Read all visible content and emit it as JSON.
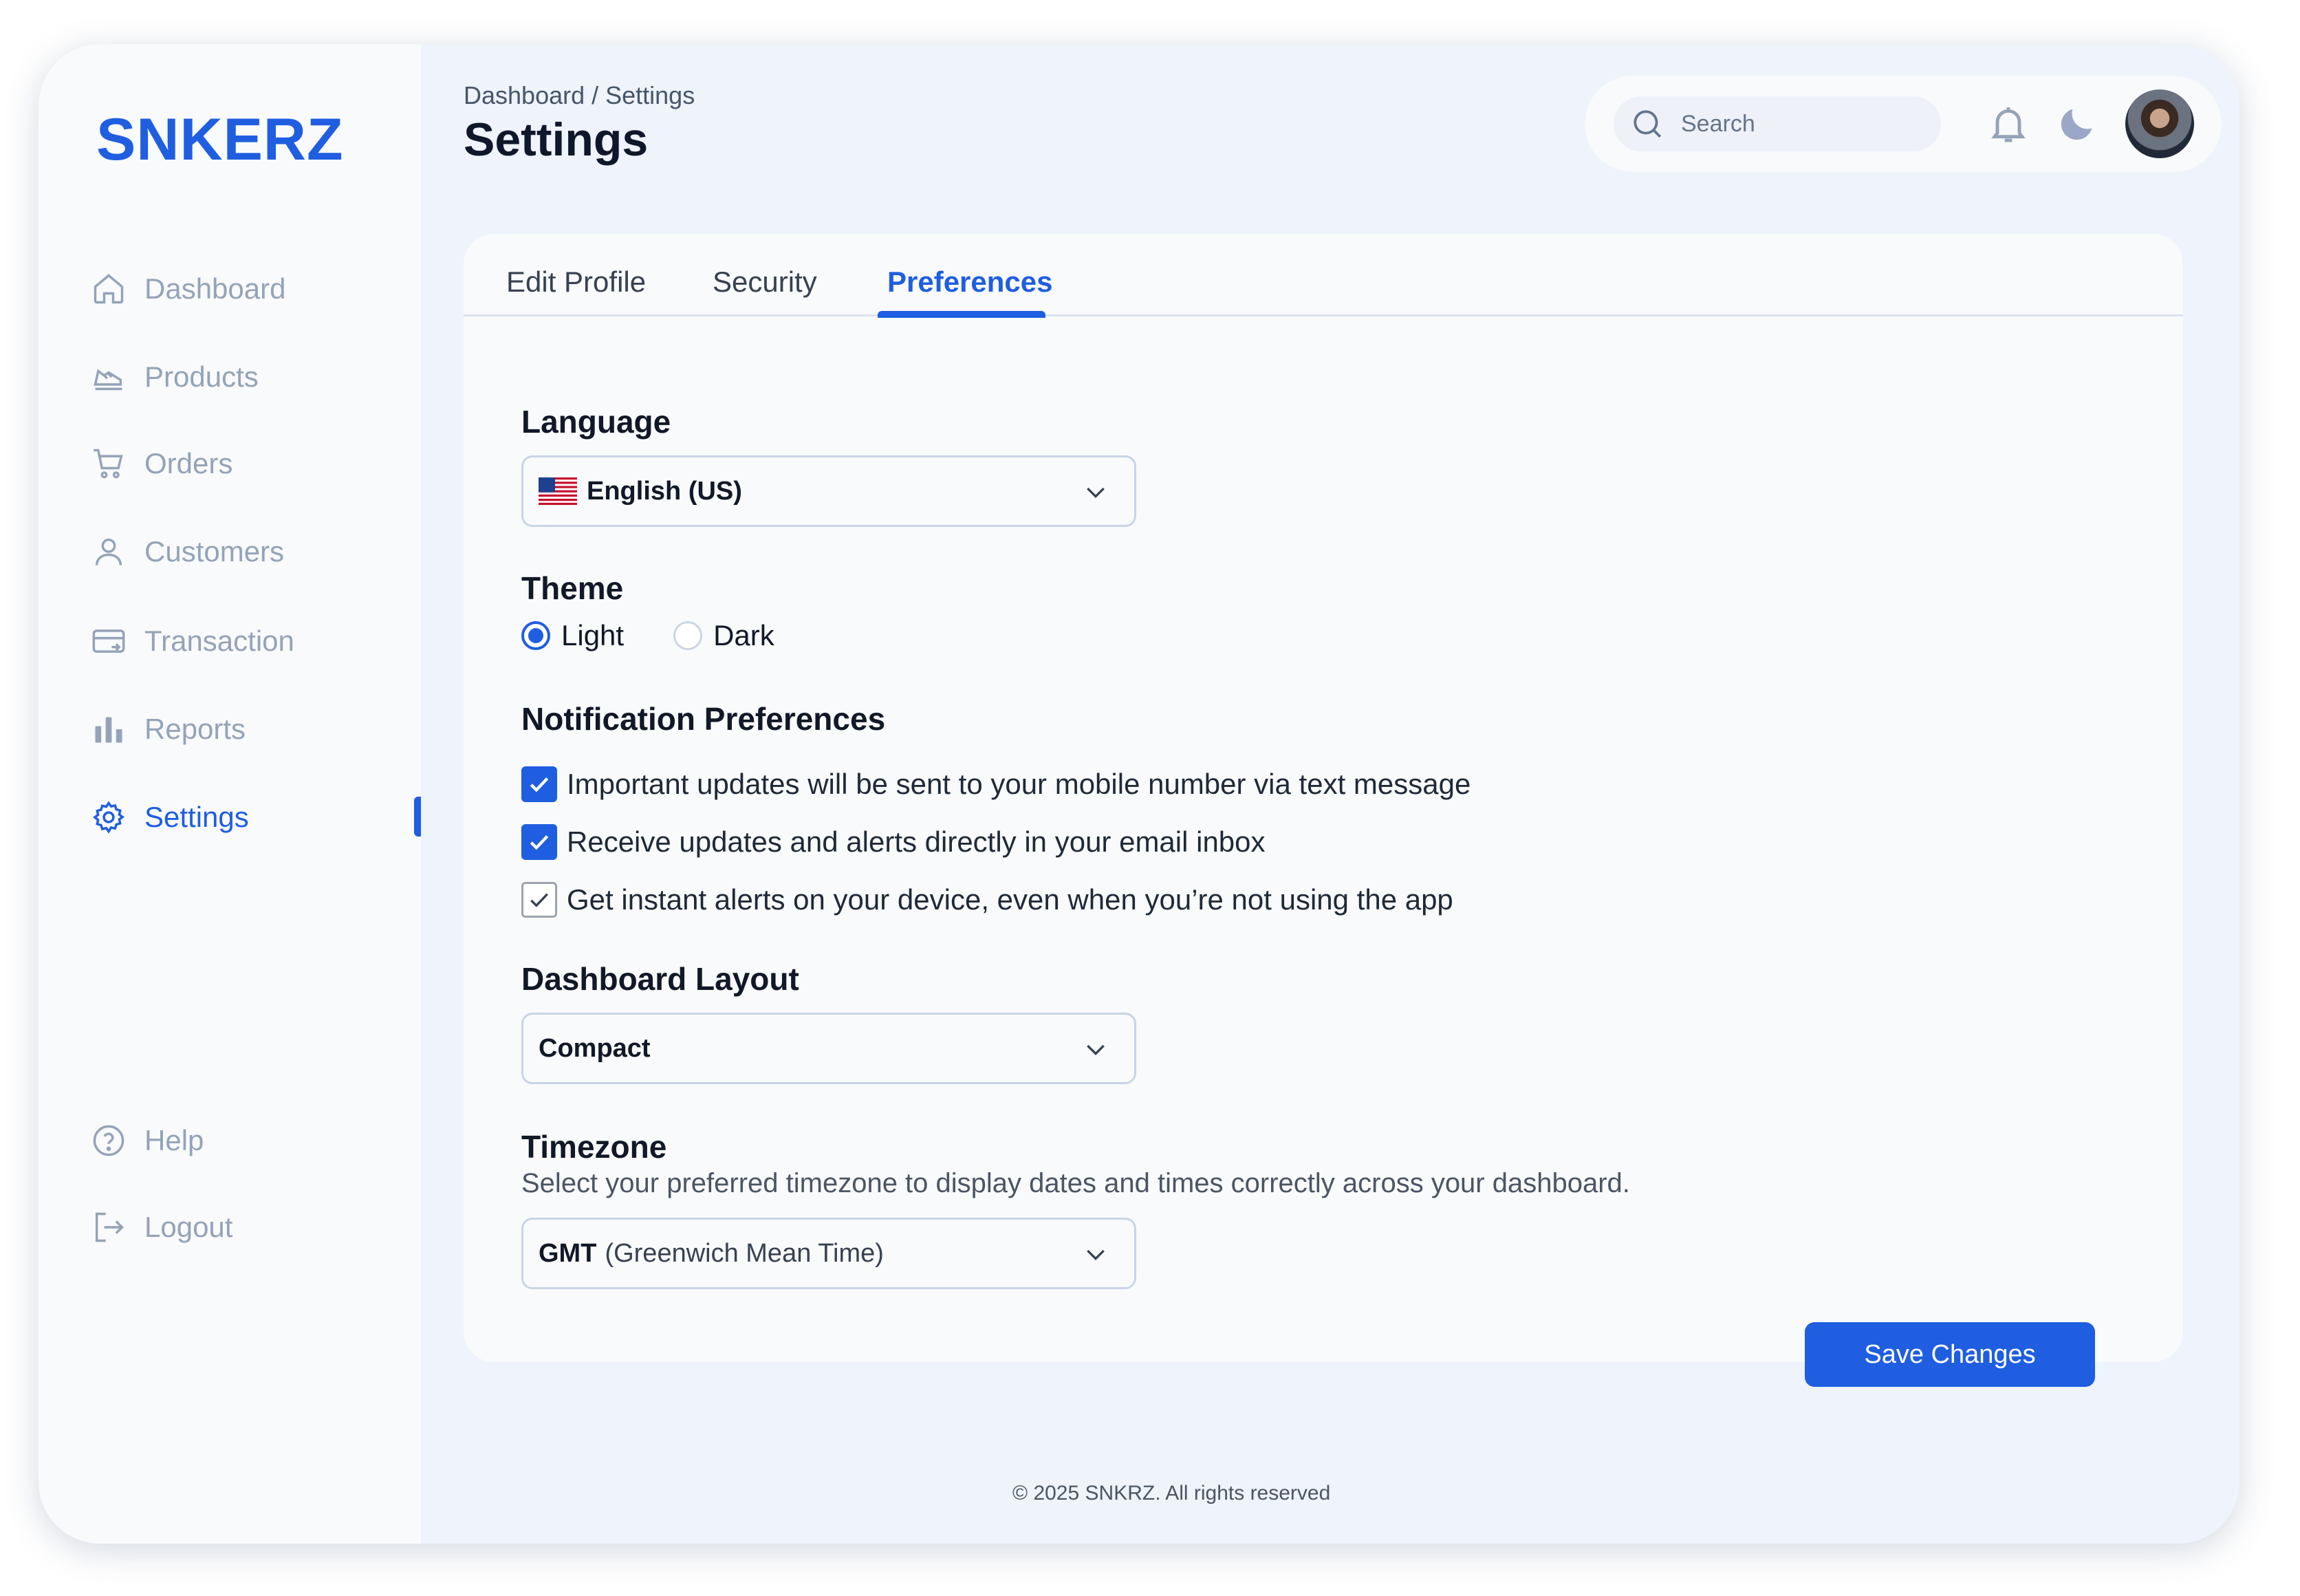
{
  "app": {
    "logo": "SNKERZ"
  },
  "sidebar": {
    "items": [
      {
        "label": "Dashboard",
        "icon": "home-icon"
      },
      {
        "label": "Products",
        "icon": "sneaker-icon"
      },
      {
        "label": "Orders",
        "icon": "cart-icon"
      },
      {
        "label": "Customers",
        "icon": "user-icon"
      },
      {
        "label": "Transaction",
        "icon": "card-icon"
      },
      {
        "label": "Reports",
        "icon": "bar-chart-icon"
      },
      {
        "label": "Settings",
        "icon": "gear-icon"
      }
    ],
    "bottom": [
      {
        "label": "Help",
        "icon": "help-icon"
      },
      {
        "label": "Logout",
        "icon": "logout-icon"
      }
    ],
    "active": "Settings"
  },
  "header": {
    "breadcrumb": "Dashboard / Settings",
    "title": "Settings",
    "search_placeholder": "Search"
  },
  "tabs": [
    {
      "label": "Edit Profile"
    },
    {
      "label": "Security"
    },
    {
      "label": "Preferences"
    }
  ],
  "preferences": {
    "language": {
      "title": "Language",
      "value": "English (US)"
    },
    "theme": {
      "title": "Theme",
      "options": [
        "Light",
        "Dark"
      ],
      "selected": "Light"
    },
    "notifications": {
      "title": "Notification Preferences",
      "items": [
        {
          "label": "Important updates will be sent to your mobile number via text message",
          "checked": true
        },
        {
          "label": "Receive updates and alerts directly in your email inbox",
          "checked": true
        },
        {
          "label": "Get instant alerts on your device, even when you’re not using the app",
          "checked": true
        }
      ]
    },
    "layout": {
      "title": "Dashboard Layout",
      "value": "Compact"
    },
    "timezone": {
      "title": "Timezone",
      "description": "Select your preferred timezone to display dates and times correctly across your dashboard.",
      "value_code": "GMT",
      "value_name": "(Greenwich Mean Time)"
    },
    "save_label": "Save Changes"
  },
  "footer": {
    "text": "© 2025 SNKRZ. All rights reserved"
  },
  "colors": {
    "accent": "#1f5ee0",
    "muted": "#94a3b8",
    "background": "#eef3fc"
  }
}
